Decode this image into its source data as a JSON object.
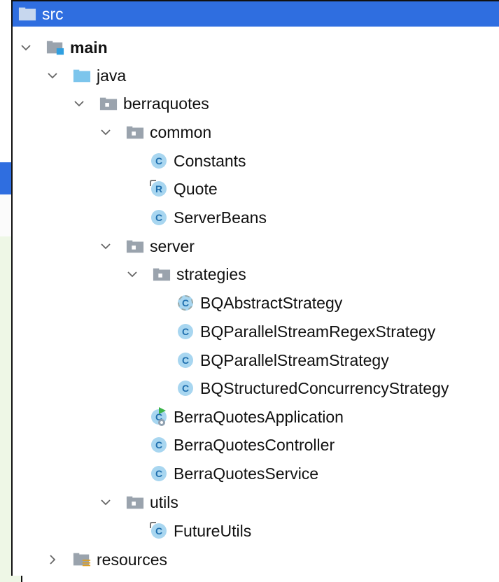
{
  "tree": {
    "root": "src",
    "items": [
      {
        "label": "main",
        "icon": "source-root-folder-icon",
        "bold": true,
        "expanded": true
      },
      {
        "label": "java",
        "icon": "java-source-folder-icon",
        "expanded": true
      },
      {
        "label": "berraquotes",
        "icon": "package-folder-icon",
        "expanded": true
      },
      {
        "label": "common",
        "icon": "package-folder-icon",
        "expanded": true
      },
      {
        "label": "Constants",
        "icon": "class-icon"
      },
      {
        "label": "Quote",
        "icon": "record-icon"
      },
      {
        "label": "ServerBeans",
        "icon": "class-icon"
      },
      {
        "label": "server",
        "icon": "package-folder-icon",
        "expanded": true
      },
      {
        "label": "strategies",
        "icon": "package-folder-icon",
        "expanded": true
      },
      {
        "label": "BQAbstractStrategy",
        "icon": "abstract-class-icon"
      },
      {
        "label": "BQParallelStreamRegexStrategy",
        "icon": "class-icon"
      },
      {
        "label": "BQParallelStreamStrategy",
        "icon": "class-icon"
      },
      {
        "label": "BQStructuredConcurrencyStrategy",
        "icon": "class-icon"
      },
      {
        "label": "BerraQuotesApplication",
        "icon": "spring-boot-application-class-icon"
      },
      {
        "label": "BerraQuotesController",
        "icon": "class-icon"
      },
      {
        "label": "BerraQuotesService",
        "icon": "class-icon"
      },
      {
        "label": "utils",
        "icon": "package-folder-icon",
        "expanded": true
      },
      {
        "label": "FutureUtils",
        "icon": "class-icon"
      },
      {
        "label": "resources",
        "icon": "resources-folder-icon",
        "expanded": false
      }
    ],
    "class_icon_letter": "C",
    "record_icon_letter": "R"
  },
  "colors": {
    "selection": "#2f6ee0",
    "class_icon_bg": "#a8d6f0",
    "class_icon_fg": "#1f6fae",
    "folder": "#9aa3ad",
    "java_folder": "#7cc5ec"
  }
}
